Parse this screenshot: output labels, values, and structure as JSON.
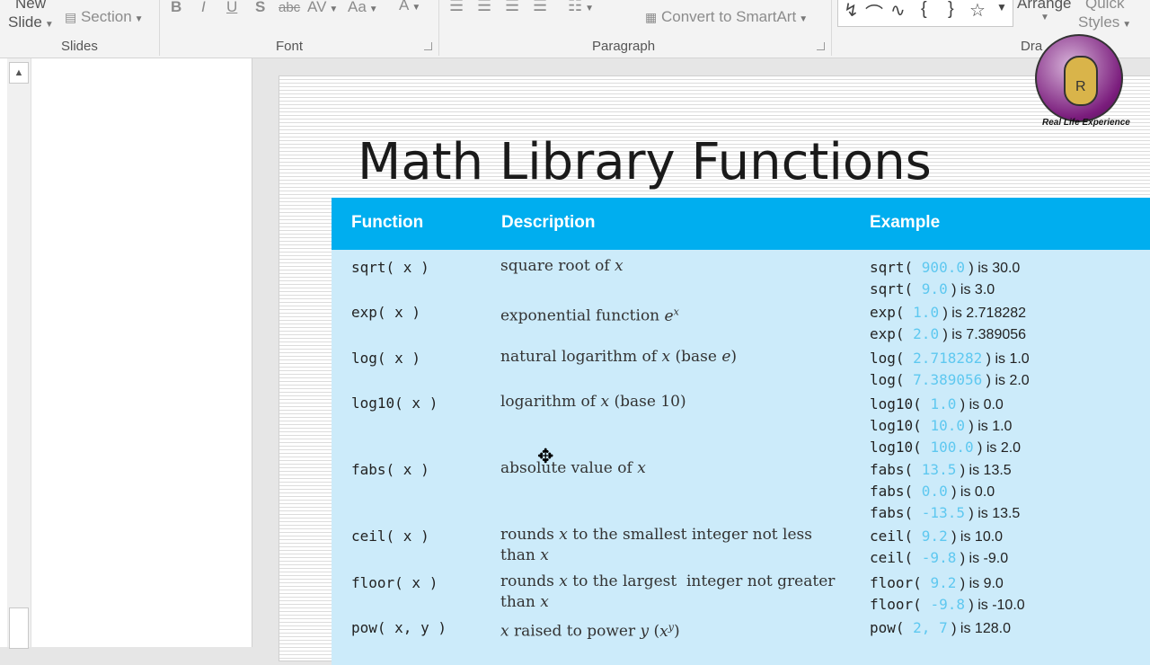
{
  "ribbon": {
    "new_slide_line1": "New",
    "new_slide_line2": "Slide",
    "section": "Section",
    "slides_group": "Slides",
    "font_group": "Font",
    "paragraph_group": "Paragraph",
    "drawing_group": "Dra",
    "convert_smartart": "Convert to SmartArt",
    "arrange": "Arrange",
    "quick": "Quick",
    "styles": "Styles",
    "font_buttons": [
      "B",
      "I",
      "U",
      "S",
      "abc",
      "AV",
      "Aa",
      "A"
    ]
  },
  "slide": {
    "title": "Math Library Functions",
    "headers": {
      "function": "Function",
      "description": "Description",
      "example": "Example"
    },
    "rows": [
      {
        "fn": "sqrt( x )",
        "desc": "square root of x",
        "ex": [
          [
            "sqrt( ",
            "900.0",
            " ) is 30.0"
          ],
          [
            "sqrt( ",
            "9.0",
            " ) is 3.0"
          ]
        ]
      },
      {
        "fn": "exp( x )",
        "desc": "exponential function e^x",
        "ex": [
          [
            "exp( ",
            "1.0",
            " ) is 2.718282"
          ],
          [
            "exp( ",
            "2.0",
            " ) is 7.389056"
          ]
        ]
      },
      {
        "fn": "log( x )",
        "desc": "natural logarithm of x (base e)",
        "ex": [
          [
            "log( ",
            "2.718282",
            " ) is 1.0"
          ],
          [
            "log( ",
            "7.389056",
            " ) is 2.0"
          ]
        ]
      },
      {
        "fn": "log10( x )",
        "desc": "logarithm of x (base 10)",
        "ex": [
          [
            "log10( ",
            "1.0",
            " ) is 0.0"
          ],
          [
            "log10( ",
            "10.0",
            " ) is 1.0"
          ],
          [
            "log10( ",
            "100.0",
            " ) is 2.0"
          ]
        ]
      },
      {
        "fn": "fabs( x )",
        "desc": "absolute value of x",
        "ex": [
          [
            "fabs( ",
            "13.5",
            " ) is 13.5"
          ],
          [
            "fabs( ",
            "0.0",
            " ) is 0.0"
          ],
          [
            "fabs( ",
            "-13.5",
            " ) is 13.5"
          ]
        ]
      },
      {
        "fn": "ceil( x )",
        "desc": "rounds x to the smallest integer not less than x",
        "ex": [
          [
            "ceil( ",
            "9.2",
            " ) is 10.0"
          ],
          [
            "ceil( ",
            "-9.8",
            " ) is -9.0"
          ]
        ]
      },
      {
        "fn": "floor( x )",
        "desc": "rounds x to the largest  integer not greater than x",
        "ex": [
          [
            "floor( ",
            "9.2",
            " ) is 9.0"
          ],
          [
            "floor( ",
            "-9.8",
            " ) is -10.0"
          ]
        ]
      },
      {
        "fn": "pow( x, y )",
        "desc": "x raised to power y (x^y)",
        "ex": [
          [
            "pow( ",
            "2, 7",
            " ) is 128.0"
          ]
        ]
      }
    ]
  },
  "logo": {
    "caption": "Real Life Experience",
    "letter": "R"
  }
}
